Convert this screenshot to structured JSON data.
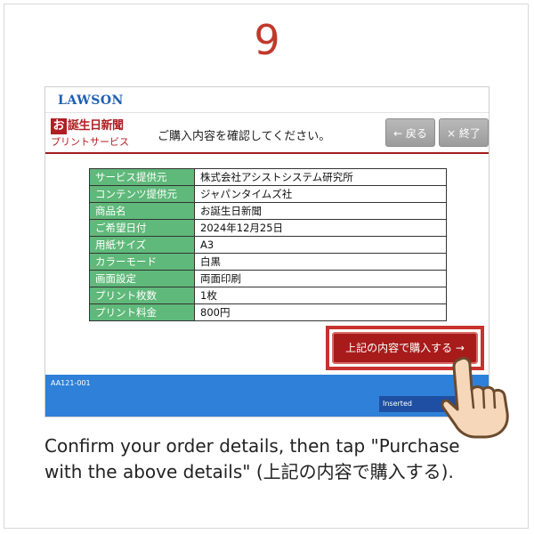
{
  "step": {
    "number": "9"
  },
  "kiosk": {
    "brand": "LAWSON",
    "service_logo": {
      "mark": "お",
      "name": "誕生日新聞",
      "sub": "プリントサービス"
    },
    "heading": "ご購入内容を確認してください。",
    "back_label": "← 戻る",
    "end_label": "× 終了",
    "details": [
      {
        "label": "サービス提供元",
        "value": "株式会社アシストシステム研究所"
      },
      {
        "label": "コンテンツ提供元",
        "value": "ジャパンタイムズ社"
      },
      {
        "label": "商品名",
        "value": "お誕生日新聞"
      },
      {
        "label": "ご希望日付",
        "value": "2024年12月25日"
      },
      {
        "label": "用紙サイズ",
        "value": "A3"
      },
      {
        "label": "カラーモード",
        "value": "白黒"
      },
      {
        "label": "画面設定",
        "value": "両面印刷"
      },
      {
        "label": "プリント枚数",
        "value": "1枚"
      },
      {
        "label": "プリント料金",
        "value": "800円"
      }
    ],
    "purchase_label": "上記の内容で購入する →",
    "screen_code": "AA121-001",
    "status": "Inserted"
  },
  "colors": {
    "step_number": "#c0392b",
    "accent_red": "#a81b1b",
    "label_green": "#5fb97a",
    "bottom_blue": "#2f80d8"
  },
  "instruction": "Confirm your order details, then tap \"Purchase with the above details\" (上記の内容で購入する)."
}
